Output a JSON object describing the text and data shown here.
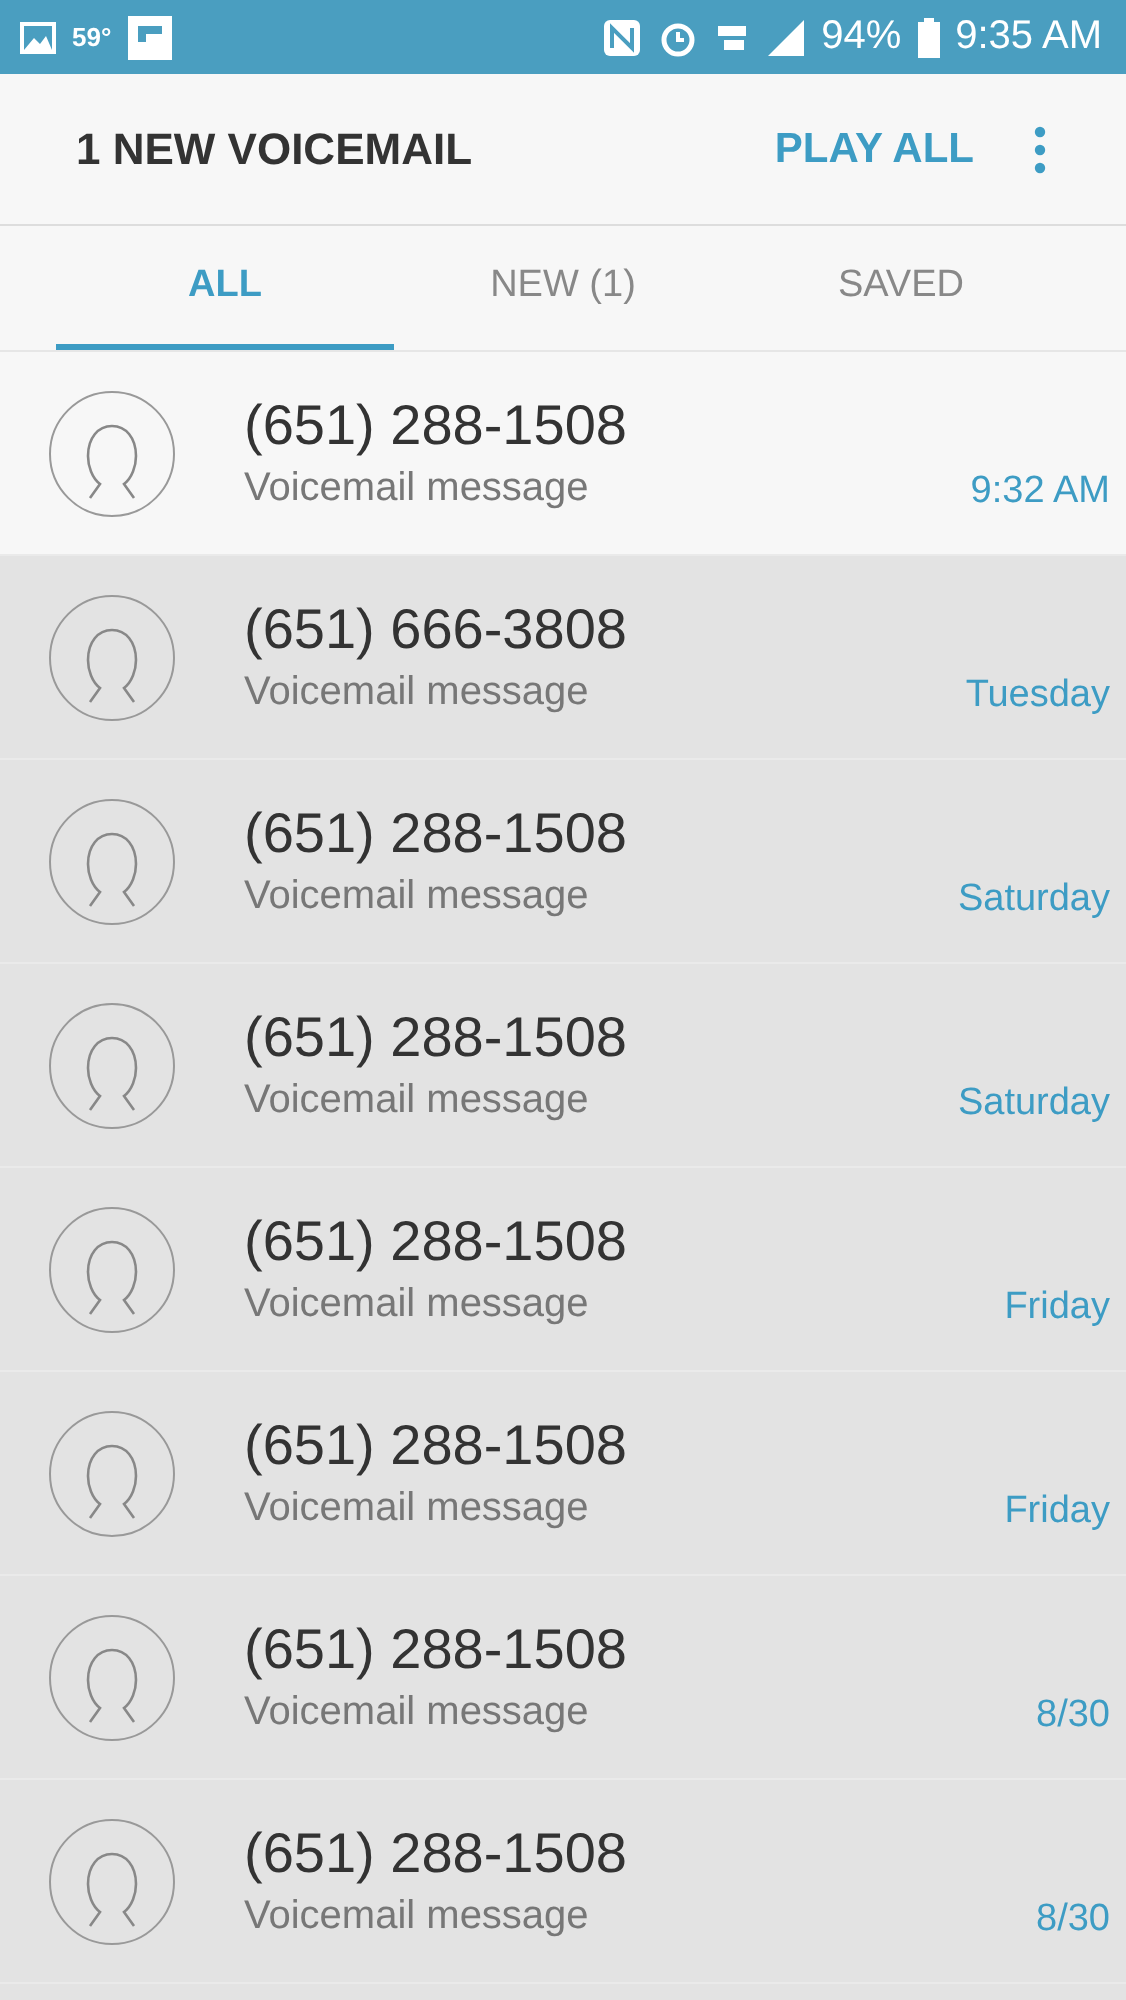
{
  "status_bar": {
    "temperature": "59°",
    "battery_percent": "94%",
    "time": "9:35 AM"
  },
  "header": {
    "title": "1 NEW VOICEMAIL",
    "action": "PLAY ALL"
  },
  "tabs": [
    {
      "label": "ALL",
      "selected": true
    },
    {
      "label": "NEW (1)",
      "selected": false
    },
    {
      "label": "SAVED",
      "selected": false
    }
  ],
  "messages": [
    {
      "number": "(651) 288-1508",
      "subtitle": "Voicemail message",
      "time": "9:32 AM",
      "new": true
    },
    {
      "number": "(651) 666-3808",
      "subtitle": "Voicemail message",
      "time": "Tuesday",
      "new": false
    },
    {
      "number": "(651) 288-1508",
      "subtitle": "Voicemail message",
      "time": "Saturday",
      "new": false
    },
    {
      "number": "(651) 288-1508",
      "subtitle": "Voicemail message",
      "time": "Saturday",
      "new": false
    },
    {
      "number": "(651) 288-1508",
      "subtitle": "Voicemail message",
      "time": "Friday",
      "new": false
    },
    {
      "number": "(651) 288-1508",
      "subtitle": "Voicemail message",
      "time": "Friday",
      "new": false
    },
    {
      "number": "(651) 288-1508",
      "subtitle": "Voicemail message",
      "time": "8/30",
      "new": false
    },
    {
      "number": "(651) 288-1508",
      "subtitle": "Voicemail message",
      "time": "8/30",
      "new": false
    }
  ]
}
